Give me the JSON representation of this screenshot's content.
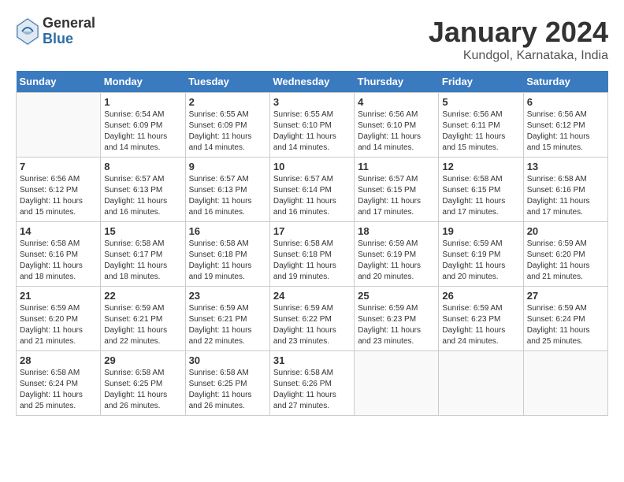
{
  "header": {
    "logo": {
      "general": "General",
      "blue": "Blue"
    },
    "title": "January 2024",
    "subtitle": "Kundgol, Karnataka, India"
  },
  "days_of_week": [
    "Sunday",
    "Monday",
    "Tuesday",
    "Wednesday",
    "Thursday",
    "Friday",
    "Saturday"
  ],
  "weeks": [
    [
      null,
      {
        "day": "1",
        "sunrise": "6:54 AM",
        "sunset": "6:09 PM",
        "daylight": "11 hours and 14 minutes."
      },
      {
        "day": "2",
        "sunrise": "6:55 AM",
        "sunset": "6:09 PM",
        "daylight": "11 hours and 14 minutes."
      },
      {
        "day": "3",
        "sunrise": "6:55 AM",
        "sunset": "6:10 PM",
        "daylight": "11 hours and 14 minutes."
      },
      {
        "day": "4",
        "sunrise": "6:56 AM",
        "sunset": "6:10 PM",
        "daylight": "11 hours and 14 minutes."
      },
      {
        "day": "5",
        "sunrise": "6:56 AM",
        "sunset": "6:11 PM",
        "daylight": "11 hours and 15 minutes."
      },
      {
        "day": "6",
        "sunrise": "6:56 AM",
        "sunset": "6:12 PM",
        "daylight": "11 hours and 15 minutes."
      }
    ],
    [
      {
        "day": "7",
        "sunrise": "6:56 AM",
        "sunset": "6:12 PM",
        "daylight": "11 hours and 15 minutes."
      },
      {
        "day": "8",
        "sunrise": "6:57 AM",
        "sunset": "6:13 PM",
        "daylight": "11 hours and 16 minutes."
      },
      {
        "day": "9",
        "sunrise": "6:57 AM",
        "sunset": "6:13 PM",
        "daylight": "11 hours and 16 minutes."
      },
      {
        "day": "10",
        "sunrise": "6:57 AM",
        "sunset": "6:14 PM",
        "daylight": "11 hours and 16 minutes."
      },
      {
        "day": "11",
        "sunrise": "6:57 AM",
        "sunset": "6:15 PM",
        "daylight": "11 hours and 17 minutes."
      },
      {
        "day": "12",
        "sunrise": "6:58 AM",
        "sunset": "6:15 PM",
        "daylight": "11 hours and 17 minutes."
      },
      {
        "day": "13",
        "sunrise": "6:58 AM",
        "sunset": "6:16 PM",
        "daylight": "11 hours and 17 minutes."
      }
    ],
    [
      {
        "day": "14",
        "sunrise": "6:58 AM",
        "sunset": "6:16 PM",
        "daylight": "11 hours and 18 minutes."
      },
      {
        "day": "15",
        "sunrise": "6:58 AM",
        "sunset": "6:17 PM",
        "daylight": "11 hours and 18 minutes."
      },
      {
        "day": "16",
        "sunrise": "6:58 AM",
        "sunset": "6:18 PM",
        "daylight": "11 hours and 19 minutes."
      },
      {
        "day": "17",
        "sunrise": "6:58 AM",
        "sunset": "6:18 PM",
        "daylight": "11 hours and 19 minutes."
      },
      {
        "day": "18",
        "sunrise": "6:59 AM",
        "sunset": "6:19 PM",
        "daylight": "11 hours and 20 minutes."
      },
      {
        "day": "19",
        "sunrise": "6:59 AM",
        "sunset": "6:19 PM",
        "daylight": "11 hours and 20 minutes."
      },
      {
        "day": "20",
        "sunrise": "6:59 AM",
        "sunset": "6:20 PM",
        "daylight": "11 hours and 21 minutes."
      }
    ],
    [
      {
        "day": "21",
        "sunrise": "6:59 AM",
        "sunset": "6:20 PM",
        "daylight": "11 hours and 21 minutes."
      },
      {
        "day": "22",
        "sunrise": "6:59 AM",
        "sunset": "6:21 PM",
        "daylight": "11 hours and 22 minutes."
      },
      {
        "day": "23",
        "sunrise": "6:59 AM",
        "sunset": "6:21 PM",
        "daylight": "11 hours and 22 minutes."
      },
      {
        "day": "24",
        "sunrise": "6:59 AM",
        "sunset": "6:22 PM",
        "daylight": "11 hours and 23 minutes."
      },
      {
        "day": "25",
        "sunrise": "6:59 AM",
        "sunset": "6:23 PM",
        "daylight": "11 hours and 23 minutes."
      },
      {
        "day": "26",
        "sunrise": "6:59 AM",
        "sunset": "6:23 PM",
        "daylight": "11 hours and 24 minutes."
      },
      {
        "day": "27",
        "sunrise": "6:59 AM",
        "sunset": "6:24 PM",
        "daylight": "11 hours and 25 minutes."
      }
    ],
    [
      {
        "day": "28",
        "sunrise": "6:58 AM",
        "sunset": "6:24 PM",
        "daylight": "11 hours and 25 minutes."
      },
      {
        "day": "29",
        "sunrise": "6:58 AM",
        "sunset": "6:25 PM",
        "daylight": "11 hours and 26 minutes."
      },
      {
        "day": "30",
        "sunrise": "6:58 AM",
        "sunset": "6:25 PM",
        "daylight": "11 hours and 26 minutes."
      },
      {
        "day": "31",
        "sunrise": "6:58 AM",
        "sunset": "6:26 PM",
        "daylight": "11 hours and 27 minutes."
      },
      null,
      null,
      null
    ]
  ],
  "labels": {
    "sunrise_prefix": "Sunrise: ",
    "sunset_prefix": "Sunset: ",
    "daylight_prefix": "Daylight: "
  }
}
